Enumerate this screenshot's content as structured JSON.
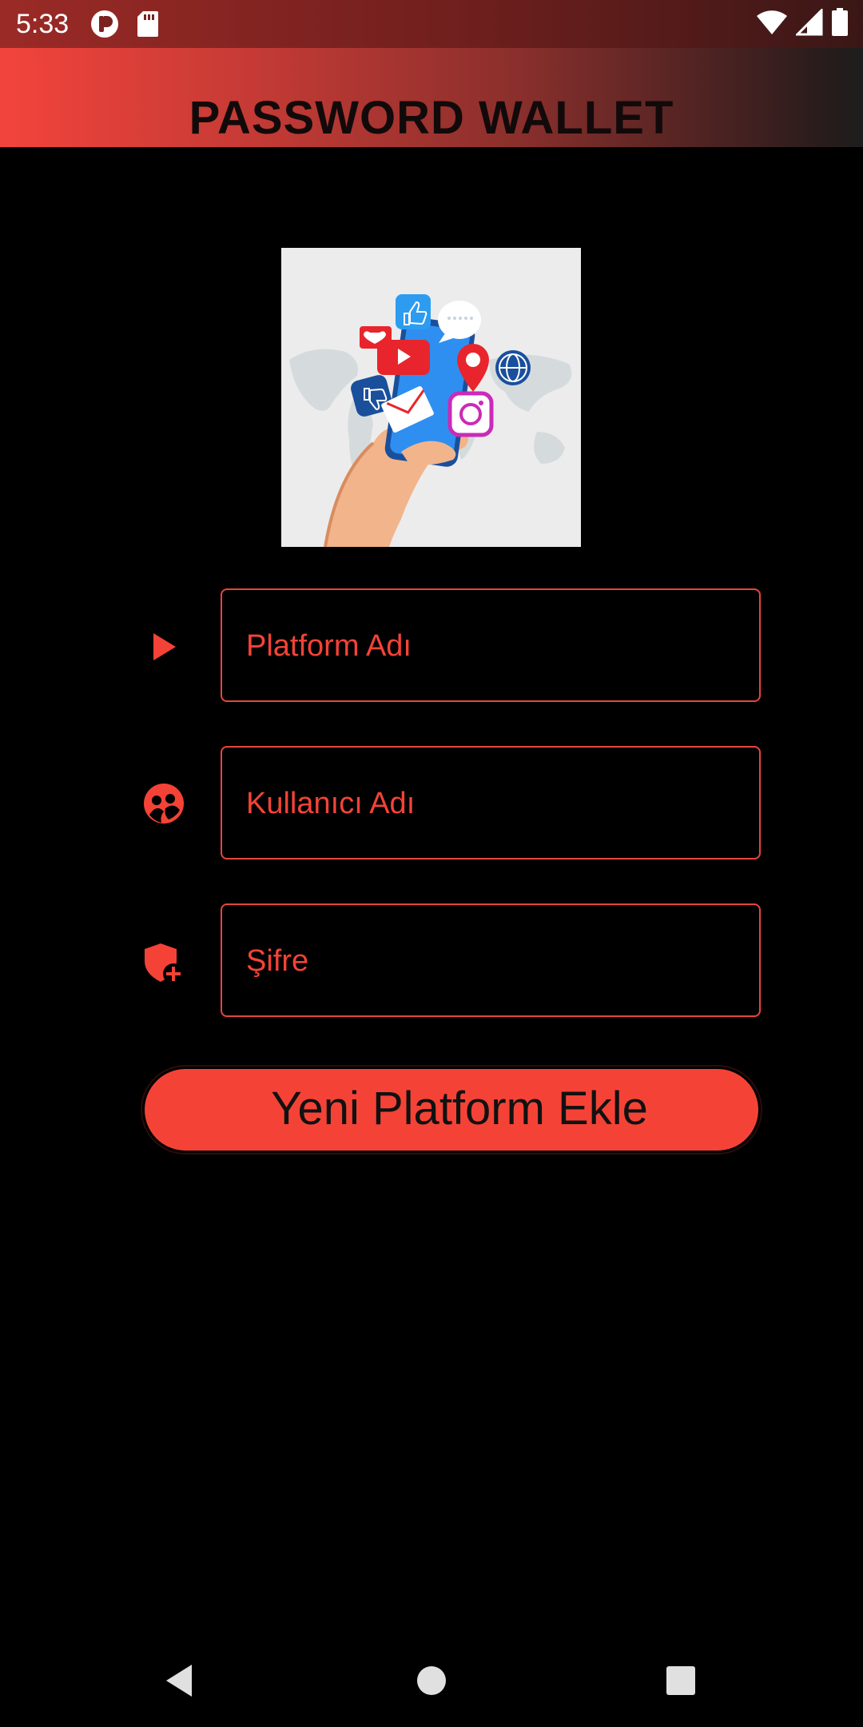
{
  "status_bar": {
    "time": "5:33",
    "left_icons": [
      "p-app-icon",
      "sd-card-icon"
    ],
    "right_icons": [
      "wifi-icon",
      "signal-icon",
      "battery-icon"
    ]
  },
  "header": {
    "title": "PASSWORD WALLET"
  },
  "illustration": {
    "description_icon": "social-media-phone-illustration"
  },
  "form": {
    "platform": {
      "icon": "play-arrow-icon",
      "placeholder": "Platform Adı"
    },
    "username": {
      "icon": "user-group-icon",
      "placeholder": "Kullanıcı Adı"
    },
    "password": {
      "icon": "shield-add-icon",
      "placeholder": "Şifre"
    },
    "submit_label": "Yeni Platform Ekle"
  },
  "nav_bar": {
    "items": [
      "back-icon",
      "home-icon",
      "recents-icon"
    ]
  },
  "colors": {
    "accent": "#f44336",
    "background": "#000000",
    "title_text": "#120a0a"
  }
}
